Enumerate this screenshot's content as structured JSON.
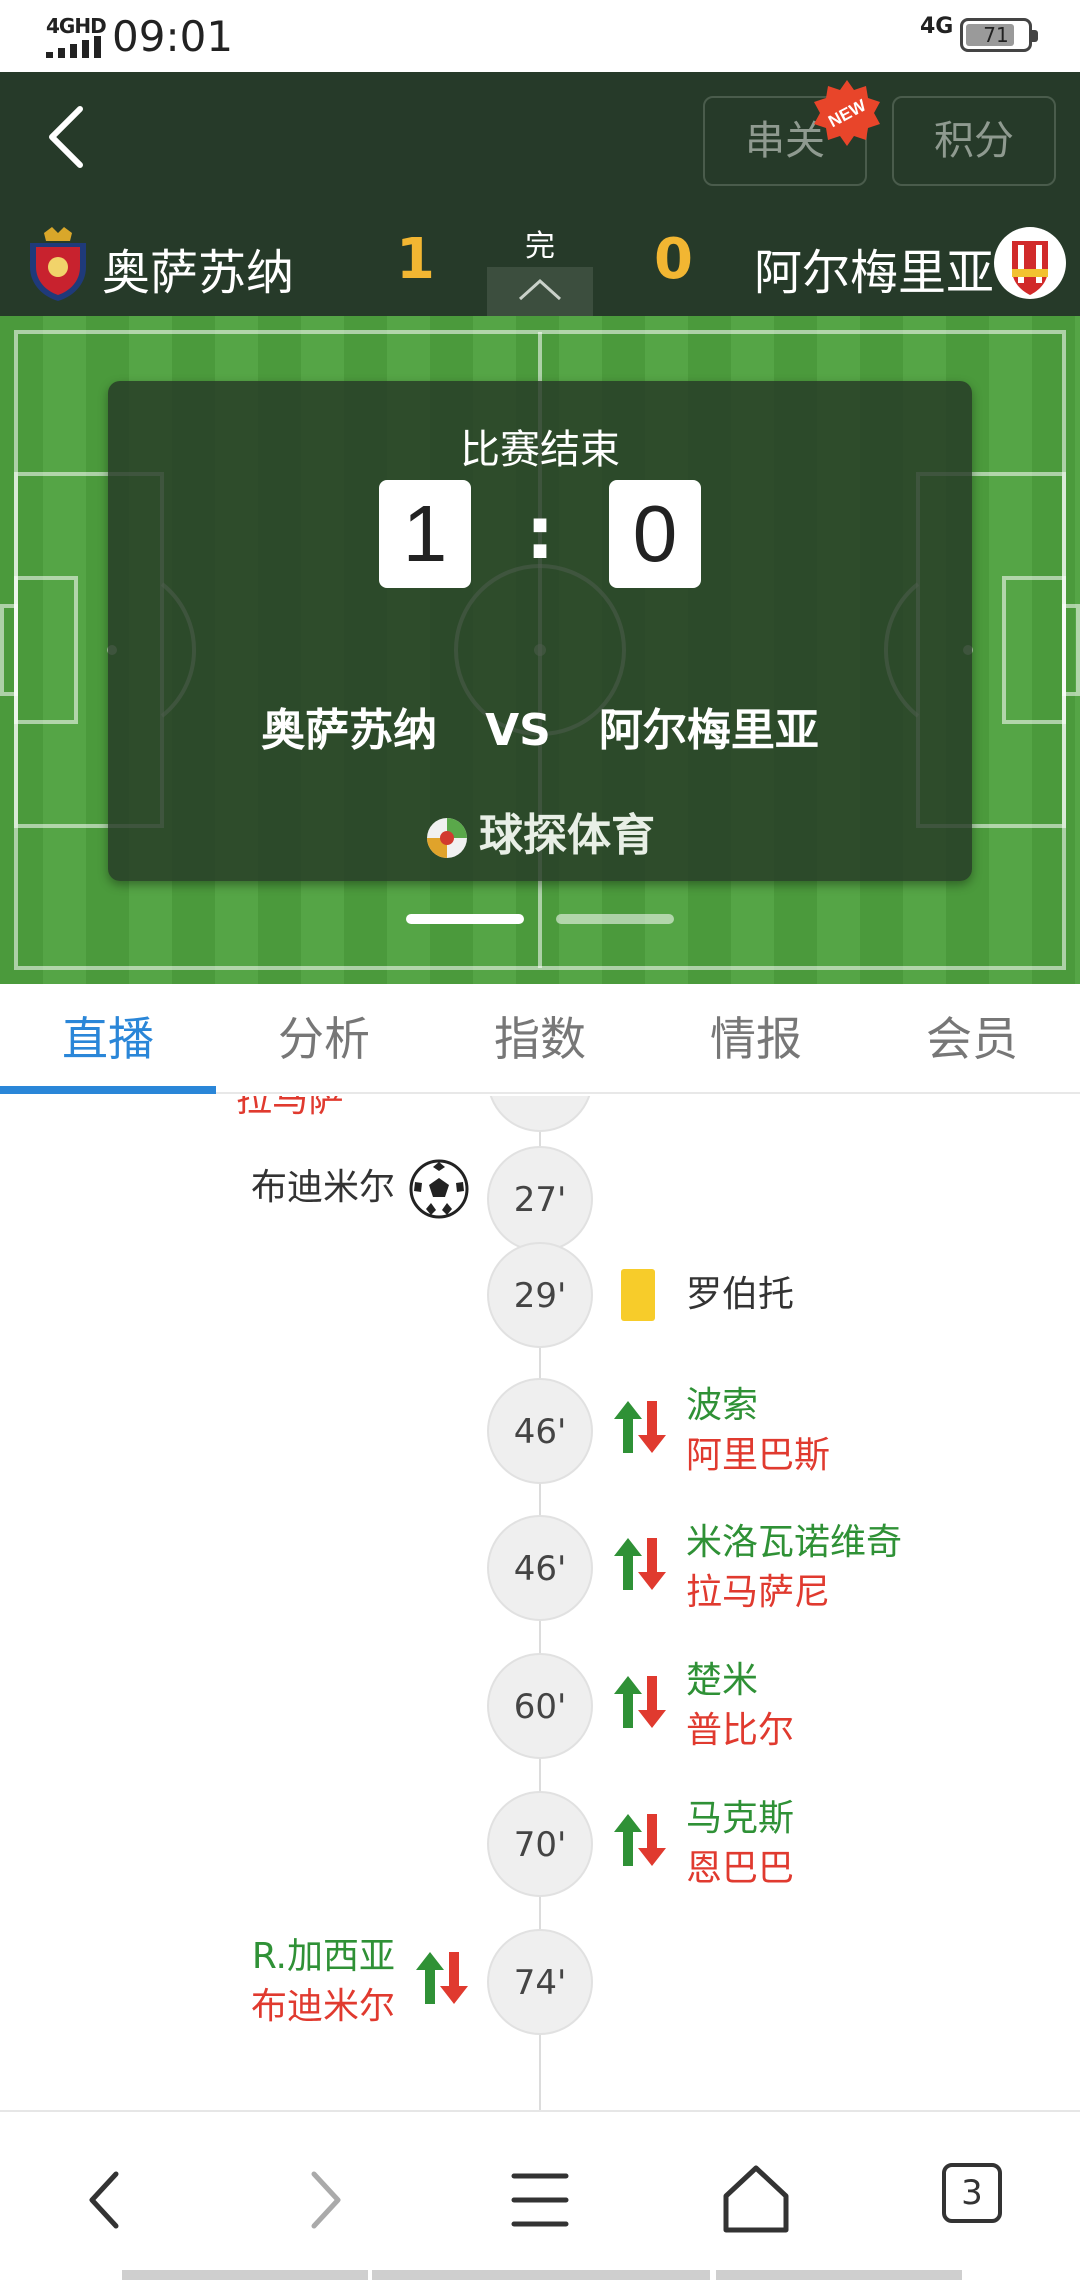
{
  "status_bar": {
    "network": "4GHD",
    "time": "09:01",
    "network_right": "4G",
    "battery": "71"
  },
  "header": {
    "parlay_label": "串关",
    "new_badge": "NEW",
    "standings_label": "积分",
    "home_team": "奥萨苏纳",
    "home_score": "1",
    "match_state": "完",
    "away_score": "0",
    "away_team": "阿尔梅里亚"
  },
  "score_panel": {
    "status": "比赛结束",
    "home_score": "1",
    "colon": ":",
    "away_score": "0",
    "home_team": "奥萨苏纳",
    "vs": "VS",
    "away_team": "阿尔梅里亚",
    "brand": "球探体育",
    "active_page": 1,
    "page_count": 2
  },
  "tabs": [
    {
      "label": "直播",
      "active": true
    },
    {
      "label": "分析",
      "active": false
    },
    {
      "label": "指数",
      "active": false
    },
    {
      "label": "情报",
      "active": false
    },
    {
      "label": "会员",
      "active": false
    }
  ],
  "timeline": {
    "partial_top_text": "拉马萨",
    "events": [
      {
        "minute": "27'",
        "side": "home",
        "type": "goal",
        "player": "布迪米尔"
      },
      {
        "minute": "29'",
        "side": "away",
        "type": "yellow-card",
        "player": "罗伯托"
      },
      {
        "minute": "46'",
        "side": "away",
        "type": "substitution",
        "player_in": "波索",
        "player_out": "阿里巴斯"
      },
      {
        "minute": "46'",
        "side": "away",
        "type": "substitution",
        "player_in": "米洛瓦诺维奇",
        "player_out": "拉马萨尼"
      },
      {
        "minute": "60'",
        "side": "away",
        "type": "substitution",
        "player_in": "楚米",
        "player_out": "普比尔"
      },
      {
        "minute": "70'",
        "side": "away",
        "type": "substitution",
        "player_in": "马克斯",
        "player_out": "恩巴巴"
      },
      {
        "minute": "74'",
        "side": "home",
        "type": "substitution",
        "player_in": "R.加西亚",
        "player_out": "布迪米尔"
      }
    ]
  },
  "bottom_bar": {
    "tab_count": "3"
  },
  "colors": {
    "header_bg": "#263a29",
    "score_accent": "#f2b632",
    "tab_active": "#2a86d8",
    "sub_in": "#2f9136",
    "sub_out": "#e03a2f",
    "yellow_card": "#f7cc2a"
  }
}
